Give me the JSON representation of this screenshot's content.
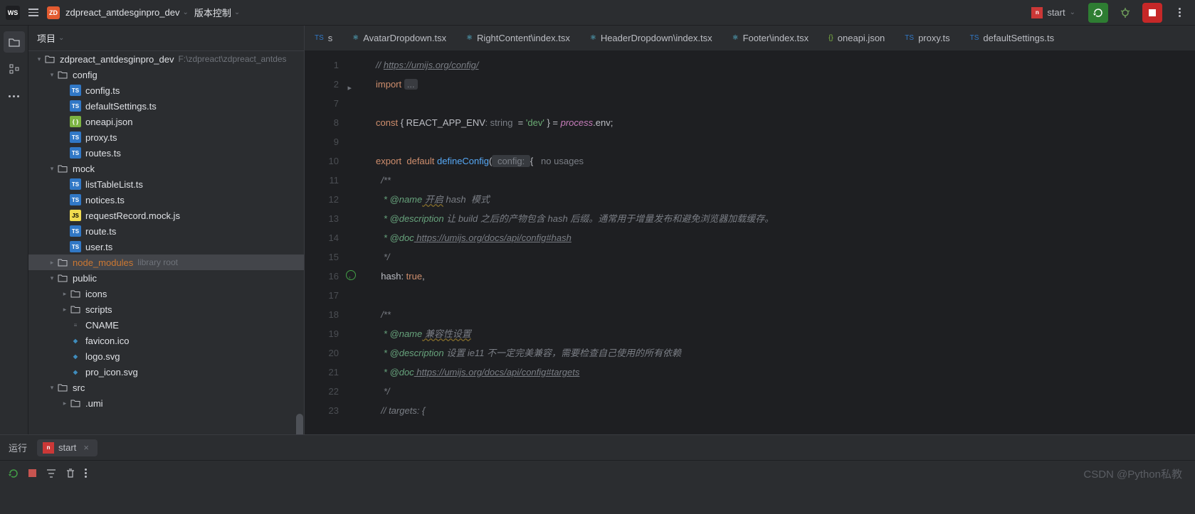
{
  "titlebar": {
    "ws": "WS",
    "proj_badge": "ZD",
    "project": "zdpreact_antdesginpro_dev",
    "vcs": "版本控制",
    "start": "start"
  },
  "tree": {
    "title": "项目",
    "root": {
      "name": "zdpreact_antdesginpro_dev",
      "path": "F:\\zdpreact\\zdpreact_antdes"
    },
    "items": [
      {
        "indent": 1,
        "arrow": "▾",
        "icon": "folder",
        "label": "config"
      },
      {
        "indent": 2,
        "arrow": "",
        "icon": "ts",
        "label": "config.ts"
      },
      {
        "indent": 2,
        "arrow": "",
        "icon": "ts",
        "label": "defaultSettings.ts"
      },
      {
        "indent": 2,
        "arrow": "",
        "icon": "json",
        "label": "oneapi.json"
      },
      {
        "indent": 2,
        "arrow": "",
        "icon": "ts",
        "label": "proxy.ts"
      },
      {
        "indent": 2,
        "arrow": "",
        "icon": "ts",
        "label": "routes.ts"
      },
      {
        "indent": 1,
        "arrow": "▾",
        "icon": "folder",
        "label": "mock"
      },
      {
        "indent": 2,
        "arrow": "",
        "icon": "ts",
        "label": "listTableList.ts"
      },
      {
        "indent": 2,
        "arrow": "",
        "icon": "ts",
        "label": "notices.ts"
      },
      {
        "indent": 2,
        "arrow": "",
        "icon": "js",
        "label": "requestRecord.mock.js"
      },
      {
        "indent": 2,
        "arrow": "",
        "icon": "ts",
        "label": "route.ts"
      },
      {
        "indent": 2,
        "arrow": "",
        "icon": "ts",
        "label": "user.ts"
      },
      {
        "indent": 1,
        "arrow": "▸",
        "icon": "folder",
        "label": "node_modules",
        "orange": true,
        "hint": "library root",
        "sel": true
      },
      {
        "indent": 1,
        "arrow": "▾",
        "icon": "folder",
        "label": "public"
      },
      {
        "indent": 2,
        "arrow": "▸",
        "icon": "folder",
        "label": "icons"
      },
      {
        "indent": 2,
        "arrow": "▸",
        "icon": "folder",
        "label": "scripts"
      },
      {
        "indent": 2,
        "arrow": "",
        "icon": "txt",
        "label": "CNAME"
      },
      {
        "indent": 2,
        "arrow": "",
        "icon": "svg",
        "label": "favicon.ico"
      },
      {
        "indent": 2,
        "arrow": "",
        "icon": "svg",
        "label": "logo.svg"
      },
      {
        "indent": 2,
        "arrow": "",
        "icon": "svg",
        "label": "pro_icon.svg"
      },
      {
        "indent": 1,
        "arrow": "▾",
        "icon": "folder",
        "label": "src"
      },
      {
        "indent": 2,
        "arrow": "▸",
        "icon": "folder",
        "label": ".umi"
      }
    ]
  },
  "tabs": [
    {
      "icon": "ts",
      "label": "s"
    },
    {
      "icon": "react",
      "label": "AvatarDropdown.tsx"
    },
    {
      "icon": "react",
      "label": "RightContent\\index.tsx"
    },
    {
      "icon": "react",
      "label": "HeaderDropdown\\index.tsx"
    },
    {
      "icon": "react",
      "label": "Footer\\index.tsx"
    },
    {
      "icon": "json",
      "label": "oneapi.json"
    },
    {
      "icon": "ts",
      "label": "proxy.ts"
    },
    {
      "icon": "ts",
      "label": "defaultSettings.ts"
    }
  ],
  "code": {
    "lines": [
      1,
      2,
      7,
      8,
      9,
      10,
      11,
      12,
      13,
      14,
      15,
      16,
      17,
      18,
      19,
      20,
      21,
      22,
      23
    ],
    "l1_link": "https://umijs.org/config/",
    "l2_kw": "import",
    "l2_fold": "...",
    "l8_kw": "const",
    "l8_br": " { REACT_APP_ENV",
    "l8_type": ": string",
    "l8_eq": "  = ",
    "l8_str": "'dev'",
    "l8_br2": " } = ",
    "l8_var": "process",
    "l8_env": ".env;",
    "l10_kw": "export  default ",
    "l10_fn": "defineConfig",
    "l10_par": "(",
    "l10_param": " config: ",
    "l10_br": "{",
    "l10_hint": "   no usages",
    "l11": "/**",
    "l12_tag": " * @name",
    "l12_cn": " 开启",
    "l12_it": " hash ",
    "l12_cn2": " 模式",
    "l13_tag": " * @description",
    "l13_cn": " 让 build 之后的产物包含 hash 后缀。通常用于增量发布和避免浏览器加载缓存。",
    "l14_tag": " * @doc",
    "l14_link": " https://umijs.org/docs/api/config#hash",
    "l15": " */",
    "l16_prop": "hash",
    "l16_col": ": ",
    "l16_kw": "true",
    "l16_com": ",",
    "l18": "/**",
    "l19_tag": " * @name",
    "l19_cn": " 兼容性设置",
    "l20_tag": " * @description",
    "l20_cn": " 设置 ie11 不一定完美兼容，需要检查自己使用的所有依赖",
    "l21_tag": " * @doc",
    "l21_link": " https://umijs.org/docs/api/config#targets",
    "l22": " */",
    "l23": "// targets: {"
  },
  "bottom": {
    "run": "运行",
    "start": "start"
  },
  "watermark": "CSDN @Python私教"
}
